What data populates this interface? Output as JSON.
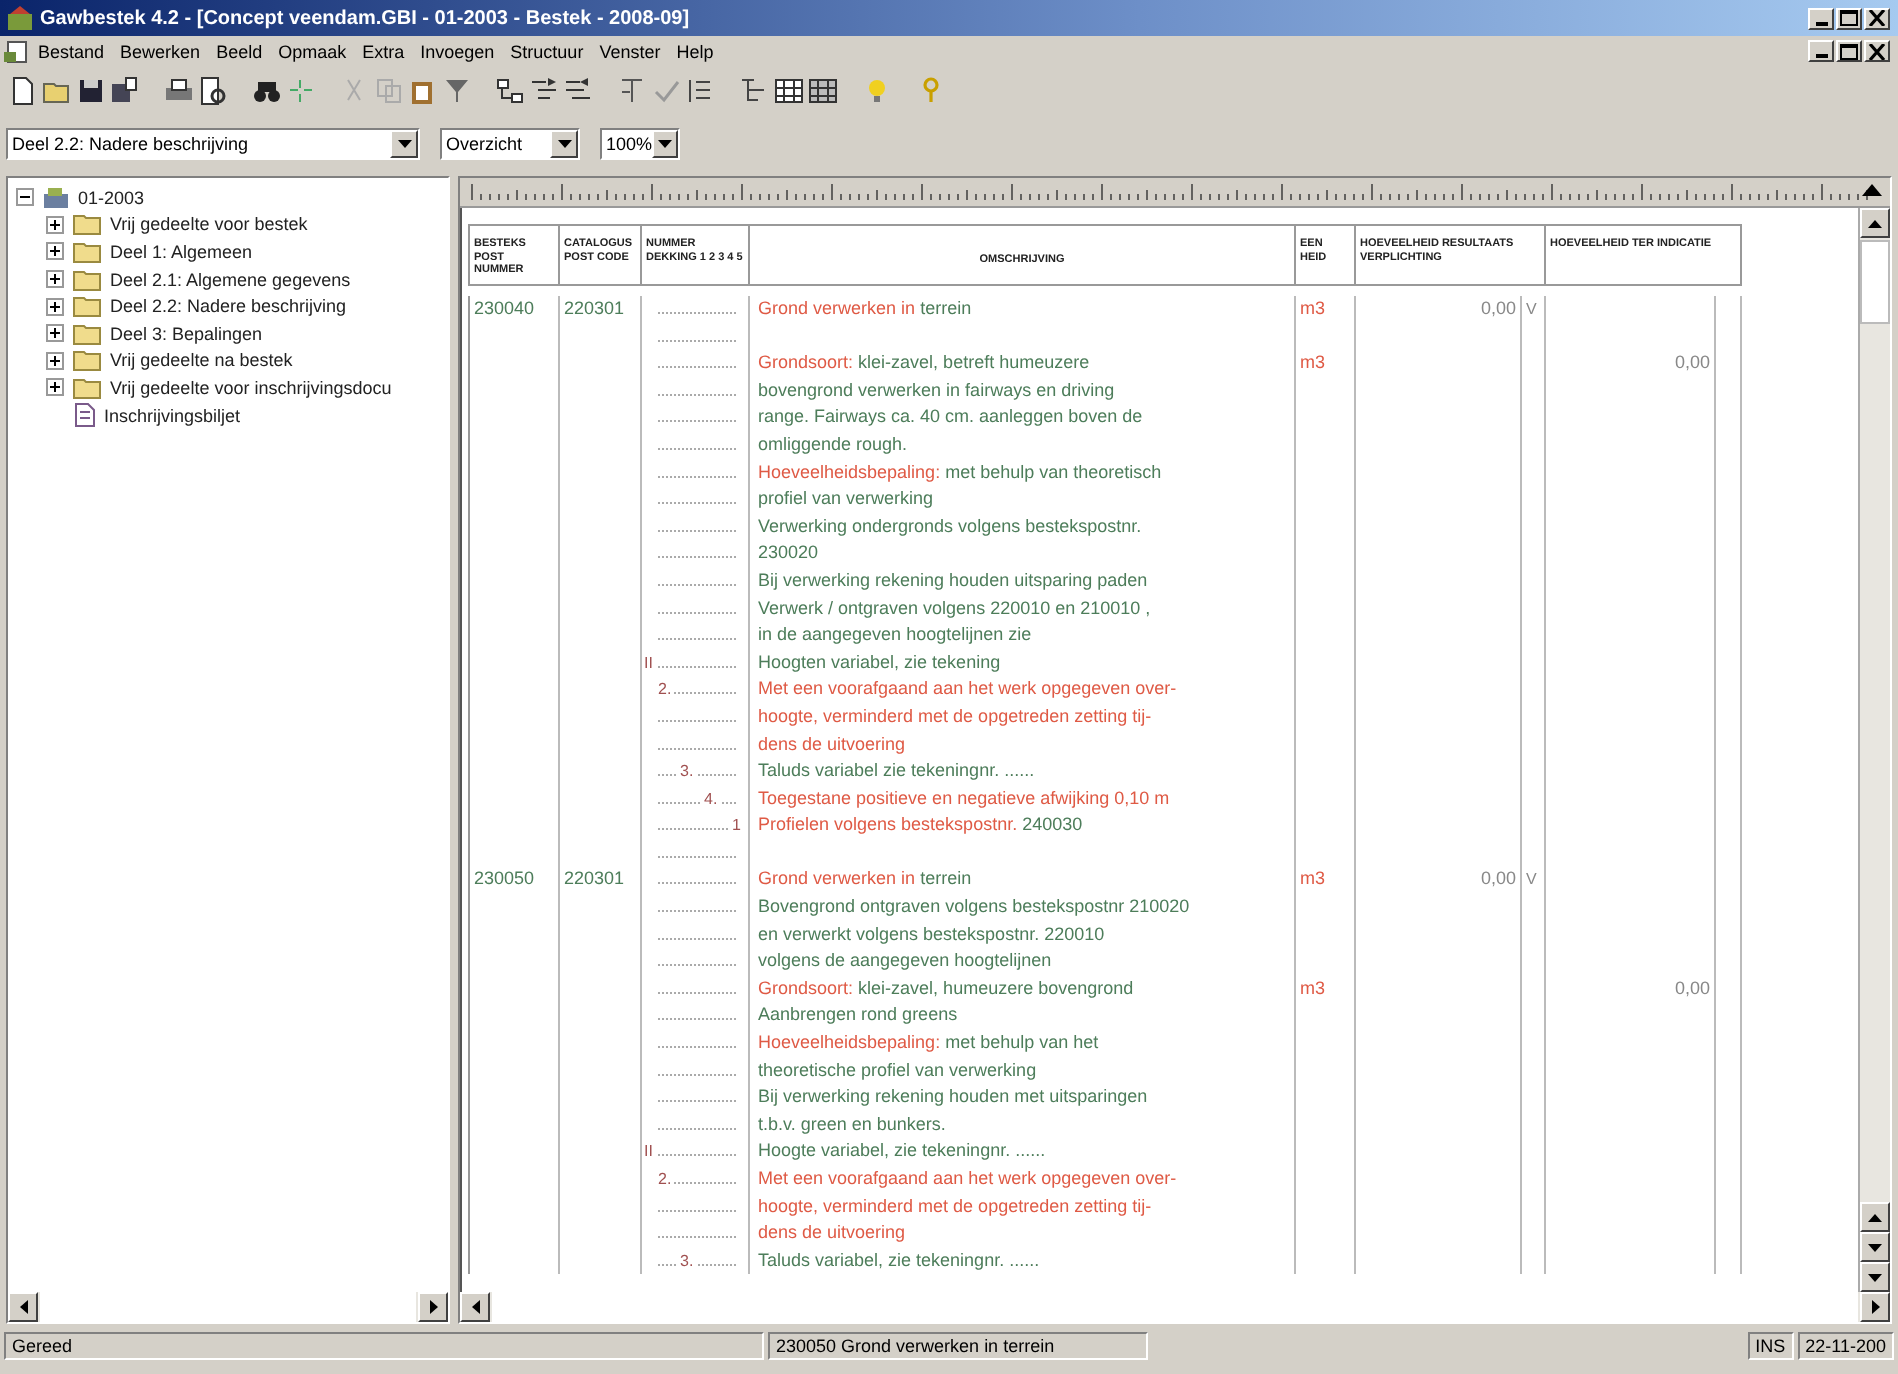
{
  "window": {
    "title": "Gawbestek 4.2 - [Concept veendam.GBI - 01-2003 - Bestek - 2008-09]"
  },
  "menu": [
    "Bestand",
    "Bewerken",
    "Beeld",
    "Opmaak",
    "Extra",
    "Invoegen",
    "Structuur",
    "Venster",
    "Help"
  ],
  "selectors": [
    {
      "value": "Deel 2.2: Nadere beschrijving",
      "kind": "wide"
    },
    {
      "value": "Overzicht",
      "kind": "medium"
    },
    {
      "value": "100%",
      "kind": "narrow"
    }
  ],
  "tree": {
    "label": "01-2003",
    "expanded": true,
    "children": [
      {
        "label": "Vrij gedeelte voor bestek",
        "kind": "folder",
        "expanded": false
      },
      {
        "label": "Deel 1: Algemeen",
        "kind": "folder",
        "expanded": false
      },
      {
        "label": "Deel 2.1: Algemene gegevens",
        "kind": "folder",
        "expanded": false
      },
      {
        "label": "Deel 2.2: Nadere beschrijving",
        "kind": "folder",
        "expanded": false
      },
      {
        "label": "Deel 3: Bepalingen",
        "kind": "folder",
        "expanded": false
      },
      {
        "label": "Vrij gedeelte na bestek",
        "kind": "folder",
        "expanded": false
      },
      {
        "label": "Vrij gedeelte voor inschrijvingsdocu",
        "kind": "folder",
        "expanded": false
      },
      {
        "label": "Inschrijvingsbiljet",
        "kind": "document"
      }
    ]
  },
  "document": {
    "columns": [
      "BESTEKS POST NUMMER",
      "CATALOGUS POST CODE",
      "NUMMER DEKKING 1 2 3 4 5",
      "OMSCHRIJVING",
      "EEN HEID",
      "HOEVEELHEID RESULTAATS VERPLICHTING",
      "HOEVEELHEID TER INDICATIE"
    ],
    "rows": [
      {
        "post_number": "230040",
        "catalog_code": "220301",
        "lines": [
          {
            "kind": "text",
            "parts": [
              {
                "text": "Grond verwerken in",
                "kind": "label"
              },
              {
                "text": "terrein",
                "kind": "plain"
              }
            ],
            "unit": "m3",
            "quantity": "0,00",
            "check": "V"
          },
          {
            "kind": "blank"
          },
          {
            "kind": "text",
            "parts": [
              {
                "text": "Grondsoort:",
                "kind": "label"
              },
              {
                "text": "klei-zavel, betreft humeuzere",
                "kind": "plain"
              }
            ],
            "unit": "m3",
            "indication": "0,00"
          },
          {
            "kind": "text",
            "parts": [
              {
                "text": "bovengrond verwerken in fairways en driving",
                "kind": "plain"
              }
            ]
          },
          {
            "kind": "text",
            "parts": [
              {
                "text": "range. Fairways ca. 40 cm. aanleggen boven de",
                "kind": "plain"
              }
            ]
          },
          {
            "kind": "text",
            "parts": [
              {
                "text": "omliggende rough.",
                "kind": "plain"
              }
            ]
          },
          {
            "kind": "text",
            "parts": [
              {
                "text": "Hoeveelheidsbepaling:",
                "kind": "label"
              },
              {
                "text": "met behulp van theoretisch",
                "kind": "plain"
              }
            ]
          },
          {
            "kind": "text",
            "parts": [
              {
                "text": "profiel van verwerking",
                "kind": "plain"
              }
            ]
          },
          {
            "kind": "text",
            "parts": [
              {
                "text": "Verwerking ondergronds volgens bestekspostnr.",
                "kind": "plain"
              }
            ]
          },
          {
            "kind": "text",
            "parts": [
              {
                "text": "230020",
                "kind": "plain"
              }
            ]
          },
          {
            "kind": "text",
            "parts": [
              {
                "text": "Bij verwerking rekening houden uitsparing paden",
                "kind": "plain"
              }
            ]
          },
          {
            "kind": "text",
            "parts": [
              {
                "text": "Verwerk / ontgraven volgens 220010 en 210010 ,",
                "kind": "plain"
              }
            ]
          },
          {
            "kind": "text",
            "parts": [
              {
                "text": "in de aangegeven hoogtelijnen zie",
                "kind": "plain"
              }
            ]
          },
          {
            "kind": "text",
            "marker": {
              "text": "II",
              "kind": "first"
            },
            "parts": [
              {
                "text": "Hoogten variabel, zie tekening",
                "kind": "plain"
              }
            ]
          },
          {
            "kind": "text",
            "marker": {
              "text": "2.",
              "kind": "second"
            },
            "parts": [
              {
                "text": "Met een voorafgaand aan het werk opgegeven over-",
                "kind": "label"
              }
            ]
          },
          {
            "kind": "text",
            "parts": [
              {
                "text": "hoogte, verminderd met de opgetreden zetting tij-",
                "kind": "label"
              }
            ]
          },
          {
            "kind": "text",
            "parts": [
              {
                "text": "dens de uitvoering",
                "kind": "label"
              }
            ]
          },
          {
            "kind": "text",
            "marker": {
              "text": "3.",
              "kind": "third"
            },
            "parts": [
              {
                "text": "Taluds variabel zie tekeningnr. ......",
                "kind": "plain"
              }
            ]
          },
          {
            "kind": "text",
            "marker": {
              "text": "4.",
              "kind": "fourth"
            },
            "parts": [
              {
                "text": "Toegestane positieve en negatieve afwijking 0,10 m",
                "kind": "label"
              }
            ]
          },
          {
            "kind": "text",
            "marker": {
              "text": "1",
              "kind": "fifth"
            },
            "parts": [
              {
                "text": "Profielen volgens bestekspostnr.",
                "kind": "label"
              },
              {
                "text": "240030",
                "kind": "plain"
              }
            ]
          },
          {
            "kind": "blank"
          }
        ]
      },
      {
        "post_number": "230050",
        "catalog_code": "220301",
        "lines": [
          {
            "kind": "text",
            "parts": [
              {
                "text": "Grond verwerken in",
                "kind": "label"
              },
              {
                "text": "terrein",
                "kind": "plain"
              }
            ],
            "unit": "m3",
            "quantity": "0,00",
            "check": "V"
          },
          {
            "kind": "text",
            "parts": [
              {
                "text": "Bovengrond ontgraven volgens bestekspostnr 210020",
                "kind": "plain"
              }
            ]
          },
          {
            "kind": "text",
            "parts": [
              {
                "text": "en verwerkt volgens  bestekspostnr. 220010",
                "kind": "plain"
              }
            ]
          },
          {
            "kind": "text",
            "parts": [
              {
                "text": "volgens de aangegeven hoogtelijnen",
                "kind": "plain"
              }
            ]
          },
          {
            "kind": "text",
            "parts": [
              {
                "text": "Grondsoort:",
                "kind": "label"
              },
              {
                "text": "klei-zavel, humeuzere bovengrond",
                "kind": "plain"
              }
            ],
            "unit": "m3",
            "indication": "0,00"
          },
          {
            "kind": "text",
            "parts": [
              {
                "text": "Aanbrengen rond greens",
                "kind": "plain"
              }
            ]
          },
          {
            "kind": "text",
            "parts": [
              {
                "text": "Hoeveelheidsbepaling:",
                "kind": "label"
              },
              {
                "text": "met behulp van het",
                "kind": "plain"
              }
            ]
          },
          {
            "kind": "text",
            "parts": [
              {
                "text": "theoretische profiel van verwerking",
                "kind": "plain"
              }
            ]
          },
          {
            "kind": "text",
            "parts": [
              {
                "text": "Bij verwerking rekening houden met uitsparingen",
                "kind": "plain"
              }
            ]
          },
          {
            "kind": "text",
            "parts": [
              {
                "text": "t.b.v. green en bunkers.",
                "kind": "plain"
              }
            ]
          },
          {
            "kind": "text",
            "marker": {
              "text": "II",
              "kind": "first"
            },
            "parts": [
              {
                "text": "Hoogte variabel, zie tekeningnr. ......",
                "kind": "plain"
              }
            ]
          },
          {
            "kind": "text",
            "marker": {
              "text": "2.",
              "kind": "second"
            },
            "parts": [
              {
                "text": "Met een voorafgaand aan het werk opgegeven over-",
                "kind": "label"
              }
            ]
          },
          {
            "kind": "text",
            "parts": [
              {
                "text": "hoogte, verminderd met de opgetreden zetting tij-",
                "kind": "label"
              }
            ]
          },
          {
            "kind": "text",
            "parts": [
              {
                "text": "dens de uitvoering",
                "kind": "label"
              }
            ]
          },
          {
            "kind": "text",
            "marker": {
              "text": "3.",
              "kind": "third"
            },
            "parts": [
              {
                "text": "Taluds variabel, zie tekeningnr. ......",
                "kind": "plain"
              }
            ]
          }
        ]
      }
    ]
  },
  "status_bar": {
    "message": "Gereed",
    "current_post": "230050  Grond verwerken in terrein",
    "mode": "INS",
    "date": "22-11-200"
  }
}
